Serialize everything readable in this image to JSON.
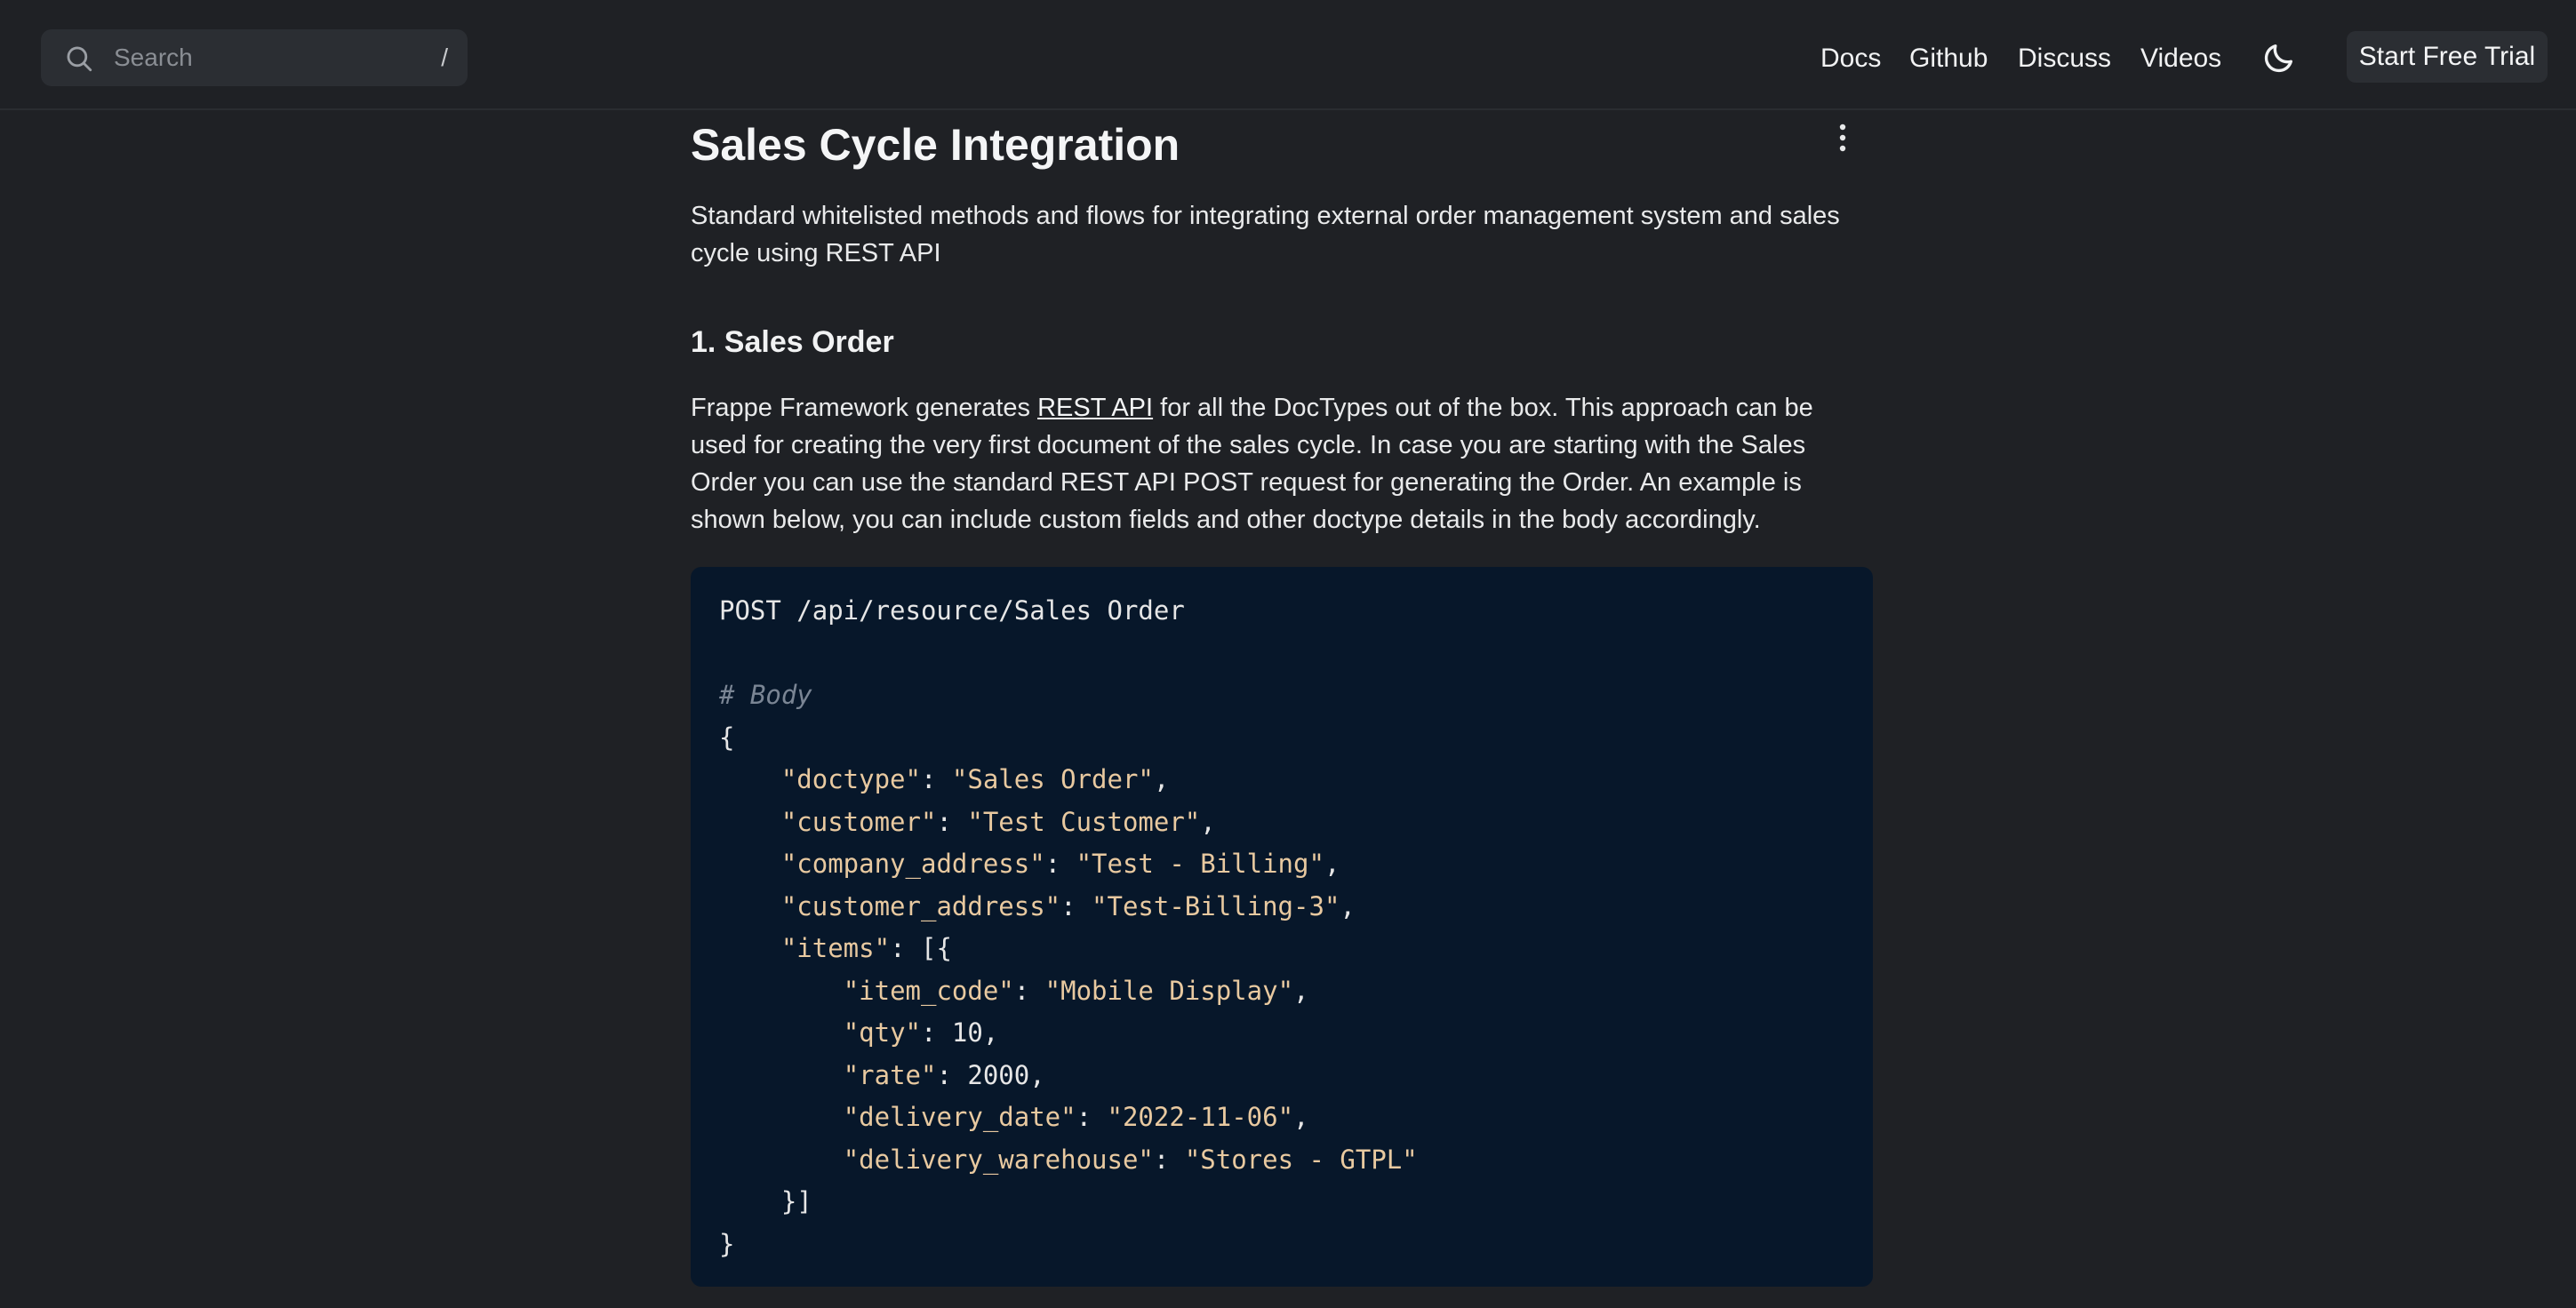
{
  "header": {
    "search_placeholder": "Search",
    "search_shortcut": "/",
    "nav": {
      "docs": "Docs",
      "github": "Github",
      "discuss": "Discuss",
      "videos": "Videos"
    },
    "theme_icon": "moon-icon",
    "trial_button": "Start Free Trial"
  },
  "page": {
    "title": "Sales Cycle Integration",
    "intro": "Standard whitelisted methods and flows for integrating external order management system and sales cycle using REST API",
    "section_heading": "1. Sales Order",
    "paragraph": {
      "before_link": "Frappe Framework generates ",
      "link_text": "REST API",
      "after_link": " for all the DocTypes out of the box. This approach can be used for creating the very first document of the sales cycle. In case you are starting with the Sales Order you can use the standard REST API POST request for generating the Order. An example is shown below, you can include custom fields and other doctype details in the body accordingly."
    }
  },
  "code": {
    "request_line": "POST /api/resource/Sales Order",
    "comment": "# Body",
    "open_brace": "{",
    "close_brace": "}",
    "items_close": "}]",
    "fields": [
      {
        "key": "\"doctype\"",
        "value": "\"Sales Order\""
      },
      {
        "key": "\"customer\"",
        "value": "\"Test Customer\""
      },
      {
        "key": "\"company_address\"",
        "value": "\"Test - Billing\""
      },
      {
        "key": "\"customer_address\"",
        "value": "\"Test-Billing-3\""
      }
    ],
    "items_key": "\"items\"",
    "item_fields": [
      {
        "key": "\"item_code\"",
        "value": "\"Mobile Display\""
      },
      {
        "key": "\"qty\"",
        "value": "10"
      },
      {
        "key": "\"rate\"",
        "value": "2000"
      },
      {
        "key": "\"delivery_date\"",
        "value": "\"2022-11-06\""
      },
      {
        "key": "\"delivery_warehouse\"",
        "value": "\"Stores - GTPL\""
      }
    ]
  },
  "colors": {
    "background": "#1f2125",
    "code_background": "#07172a",
    "code_string": "#e8c9a0",
    "code_comment": "#7a8594"
  }
}
